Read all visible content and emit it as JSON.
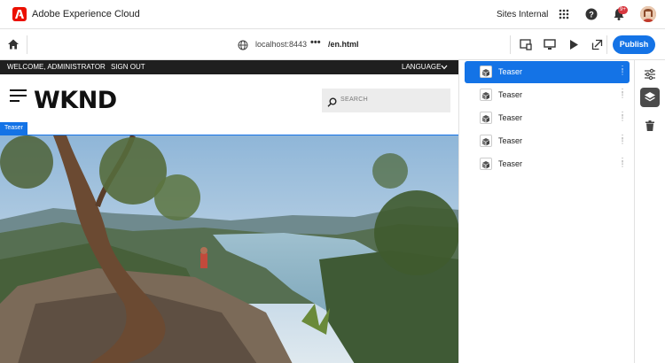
{
  "app": {
    "title": "Adobe Experience Cloud",
    "org": "Sites Internal",
    "notifications_badge": "9+"
  },
  "editor": {
    "url_host": "localhost:8443",
    "url_more": "•••",
    "url_path": "/en.html",
    "publish_label": "Publish"
  },
  "site": {
    "welcome": "WELCOME, ADMINISTRATOR",
    "sign_out": "SIGN OUT",
    "language": "LANGUAGE",
    "logo": "WKND",
    "search_placeholder": "SEARCH",
    "selected_component": "Teaser"
  },
  "layers": [
    {
      "label": "Teaser",
      "selected": true
    },
    {
      "label": "Teaser",
      "selected": false
    },
    {
      "label": "Teaser",
      "selected": false
    },
    {
      "label": "Teaser",
      "selected": false
    },
    {
      "label": "Teaser",
      "selected": false
    }
  ],
  "icons": [
    "adobe-logo-icon",
    "apps-grid-icon",
    "help-icon",
    "bell-icon",
    "home-icon",
    "globe-icon",
    "responsive-icon",
    "desktop-icon",
    "play-icon",
    "open-external-icon",
    "settings-sliders-icon",
    "layers-icon",
    "trash-icon",
    "cube-icon",
    "drag-handle-icon",
    "search-icon",
    "hamburger-icon",
    "chevron-down-icon"
  ],
  "colors": {
    "accent": "#1473e6",
    "brand": "#eb1000",
    "badge": "#d7373f",
    "nav": "#1f1f1f"
  }
}
